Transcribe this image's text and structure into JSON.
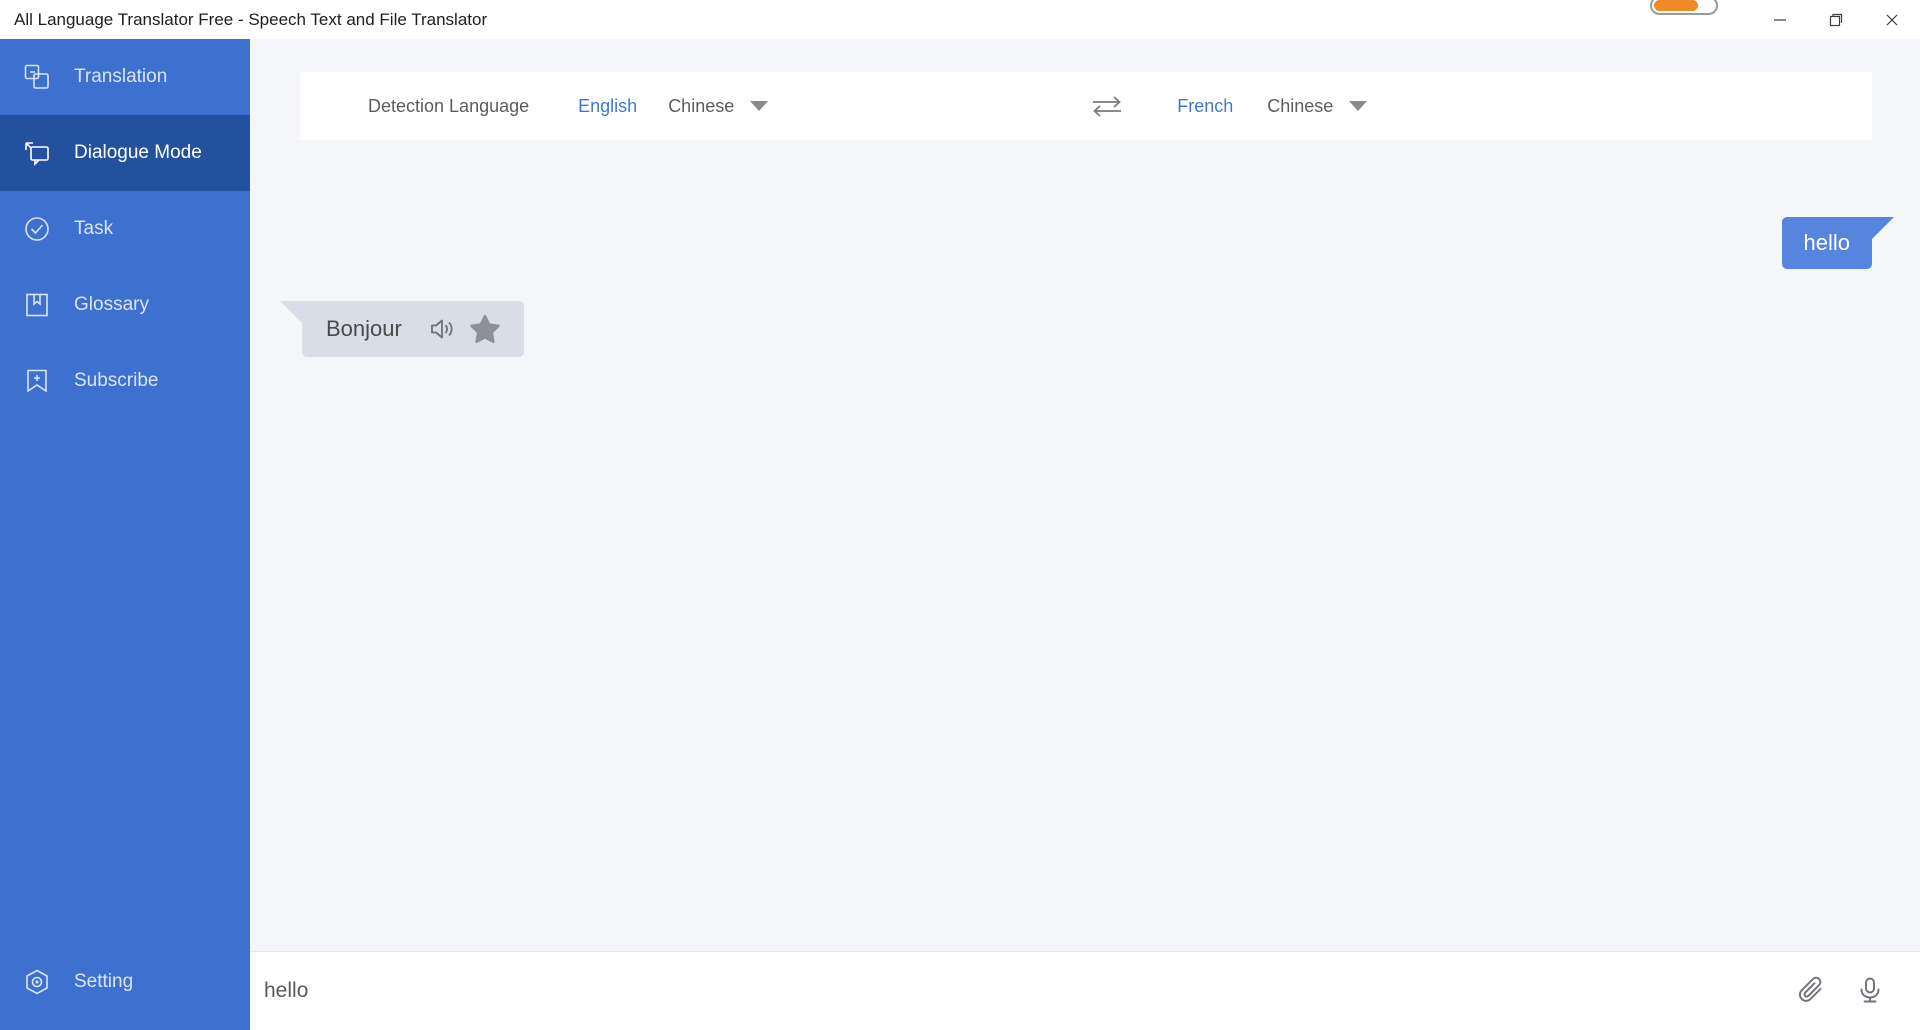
{
  "window": {
    "title": "All Language Translator Free - Speech Text and File Translator",
    "progress_pill": {
      "name": "progress-indicator",
      "fill_percent": 68,
      "color": "#f08a24"
    },
    "controls": {
      "minimize": "minimize-icon",
      "maximize": "maximize-icon",
      "close": "close-icon"
    }
  },
  "sidebar": {
    "background": "#3d70cf",
    "active_background": "#24519e",
    "items": [
      {
        "label": "Translation",
        "icon": "translation-icon",
        "active": false
      },
      {
        "label": "Dialogue Mode",
        "icon": "dialogue-icon",
        "active": true
      },
      {
        "label": "Task",
        "icon": "task-check-icon",
        "active": false
      },
      {
        "label": "Glossary",
        "icon": "glossary-book-icon",
        "active": false
      },
      {
        "label": "Subscribe",
        "icon": "subscribe-bookmark-icon",
        "active": false
      }
    ],
    "setting": {
      "label": "Setting",
      "icon": "setting-gear-icon"
    }
  },
  "language_bar": {
    "detection_label": "Detection Language",
    "source_active": "English",
    "source_select": "Chinese",
    "swap_icon": "swap-arrows-icon",
    "target_active": "French",
    "target_select": "Chinese",
    "accent_color": "#3c78dc"
  },
  "chat": {
    "messages": [
      {
        "side": "right",
        "text": "hello",
        "bubble_color": "#5784de",
        "text_color": "#ffffff"
      },
      {
        "side": "left",
        "text": "Bonjour",
        "bubble_color": "#d8dde8",
        "text_color": "#4a4a4a",
        "actions": [
          "speaker-icon",
          "star-icon"
        ]
      }
    ]
  },
  "input_bar": {
    "value": "hello",
    "placeholder": "",
    "attach_icon": "paperclip-icon",
    "mic_icon": "microphone-icon"
  }
}
